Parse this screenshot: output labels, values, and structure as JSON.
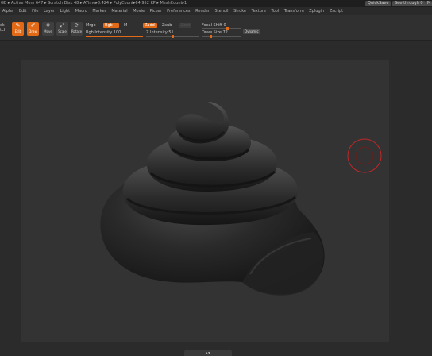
{
  "status": {
    "stats": "GB ▸ Active Mem 647 ▸ Scratch Disk 48 ▸ ATime▸8.424 ▸ PolyCount▸64.952 KP ▸ MeshCount▸1",
    "quicksave": "QuickSave",
    "see_through": "See-through",
    "see_through_value": "0",
    "menu_btn": "M"
  },
  "menu": [
    "Alpha",
    "Edit",
    "File",
    "Layer",
    "Light",
    "Macro",
    "Marker",
    "Material",
    "Movie",
    "Picker",
    "Preferences",
    "Render",
    "Stencil",
    "Stroke",
    "Texture",
    "Tool",
    "Transform",
    "Zplugin",
    "Zscript"
  ],
  "toolbar": {
    "left_label_1": "ck",
    "left_label_2": "tch",
    "buttons": [
      {
        "label": "Edit",
        "glyph": "✎"
      },
      {
        "label": "Draw",
        "glyph": "✐"
      },
      {
        "label": "Move",
        "glyph": "✥"
      },
      {
        "label": "Scale",
        "glyph": "⤢"
      },
      {
        "label": "Rotate",
        "glyph": "⟳"
      }
    ],
    "mrgb": "Mrgb",
    "rgb": "Rgb",
    "m": "M",
    "zadd": "Zadd",
    "zsub": "Zsub",
    "zcut": "Zcut",
    "rgb_intensity_label": "Rgb Intensity 100",
    "rgb_intensity": 100,
    "z_intensity_label": "Z Intensity 51",
    "z_intensity": 51,
    "focal_shift_label": "Focal Shift 0",
    "draw_size_label": "Draw Size 72",
    "dynamic": "Dynamic"
  },
  "colors": {
    "accent": "#e26a16",
    "cursor": "#c02828",
    "canvas": "#333333"
  }
}
